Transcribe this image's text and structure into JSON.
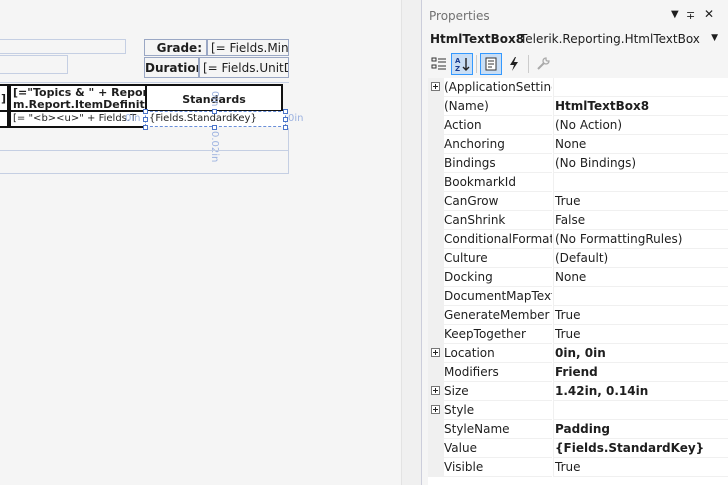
{
  "designer": {
    "grade_label": "Grade:",
    "grade_expr": "[= Fields.Min",
    "duration_label": "Duration:",
    "duration_expr": "[= Fields.UnitDu",
    "cell_left": "]",
    "topics_line1": "[=\"Topics & \" + ReportIte",
    "topics_line2": "m.Report.ItemDefinition.D",
    "standards_header": "Standards",
    "html_expr": "[= \"<b><u>\" + Fields.T",
    "std_key_expr": "{Fields.StandardKey}",
    "dim_left": "0in",
    "dim_right": "0in",
    "dim_top": "0in",
    "dim_bottom": "0.02in"
  },
  "properties": {
    "title": "Properties",
    "object_name": "HtmlTextBox8",
    "object_type": "Telerik.Reporting.HtmlTextBox",
    "rows": [
      {
        "name": "(ApplicationSettings",
        "value": "",
        "expandable": true,
        "bold": false
      },
      {
        "name": "(Name)",
        "value": "HtmlTextBox8",
        "expandable": false,
        "bold": true
      },
      {
        "name": "Action",
        "value": "(No Action)",
        "expandable": false,
        "bold": false
      },
      {
        "name": "Anchoring",
        "value": "None",
        "expandable": false,
        "bold": false
      },
      {
        "name": "Bindings",
        "value": "(No Bindings)",
        "expandable": false,
        "bold": false
      },
      {
        "name": "BookmarkId",
        "value": "",
        "expandable": false,
        "bold": false
      },
      {
        "name": "CanGrow",
        "value": "True",
        "expandable": false,
        "bold": false
      },
      {
        "name": "CanShrink",
        "value": "False",
        "expandable": false,
        "bold": false
      },
      {
        "name": "ConditionalFormatt",
        "value": "(No FormattingRules)",
        "expandable": false,
        "bold": false
      },
      {
        "name": "Culture",
        "value": "(Default)",
        "expandable": false,
        "bold": false
      },
      {
        "name": "Docking",
        "value": "None",
        "expandable": false,
        "bold": false
      },
      {
        "name": "DocumentMapText",
        "value": "",
        "expandable": false,
        "bold": false
      },
      {
        "name": "GenerateMember",
        "value": "True",
        "expandable": false,
        "bold": false
      },
      {
        "name": "KeepTogether",
        "value": "True",
        "expandable": false,
        "bold": false
      },
      {
        "name": "Location",
        "value": "0in, 0in",
        "expandable": true,
        "bold": true
      },
      {
        "name": "Modifiers",
        "value": "Friend",
        "expandable": false,
        "bold": true
      },
      {
        "name": "Size",
        "value": "1.42in, 0.14in",
        "expandable": true,
        "bold": true
      },
      {
        "name": "Style",
        "value": "",
        "expandable": true,
        "bold": false
      },
      {
        "name": "StyleName",
        "value": "Padding",
        "expandable": false,
        "bold": true
      },
      {
        "name": "Value",
        "value": "{Fields.StandardKey}",
        "expandable": false,
        "bold": true
      },
      {
        "name": "Visible",
        "value": "True",
        "expandable": false,
        "bold": false
      }
    ]
  },
  "icons": {
    "pin": "pin-icon",
    "close": "close-icon",
    "menu": "window-menu-icon"
  }
}
